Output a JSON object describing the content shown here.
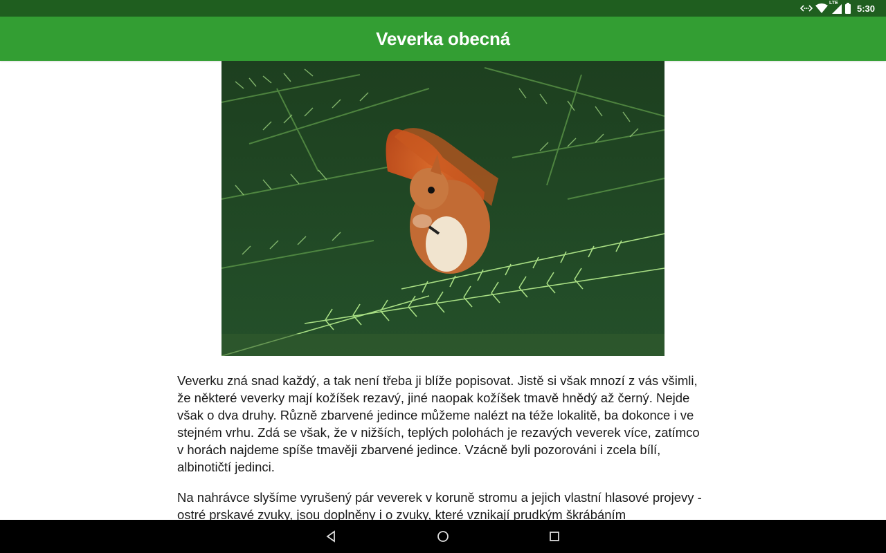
{
  "status_bar": {
    "time": "5:30",
    "network_label": "LTE",
    "icons": [
      "data-sync-icon",
      "wifi-icon",
      "lte-signal-icon",
      "battery-icon"
    ]
  },
  "app_bar": {
    "title": "Veverka obecná",
    "color": "#339e33",
    "status_color": "#1f5e1f"
  },
  "image": {
    "subject": "red-squirrel-photo"
  },
  "article": {
    "paragraphs": [
      "Veverku zná snad každý, a tak není třeba ji blíže popisovat. Jistě si však mnozí z vás všimli, že některé veverky mají kožíšek rezavý, jiné naopak kožíšek tmavě hnědý až černý. Nejde však o dva druhy. Různě zbarvené jedince můžeme nalézt na téže lokalitě, ba dokonce i ve stejném vrhu. Zdá se však, že v nižších, teplých polohách je rezavých veverek více, zatímco v horách najdeme spíše tmavěji zbarvené jedince. Vzácně byli pozorováni i zcela bílí, albinotičtí jedinci.",
      "Na nahrávce slyšíme vyrušený pár veverek v koruně stromu a jejich vlastní hlasové projevy - ostré prskavé zvuky, jsou doplněny i o zvuky, které vznikají prudkým škrábáním"
    ]
  },
  "nav_bar": {
    "icons": [
      "back-icon",
      "home-icon",
      "recents-icon"
    ]
  }
}
